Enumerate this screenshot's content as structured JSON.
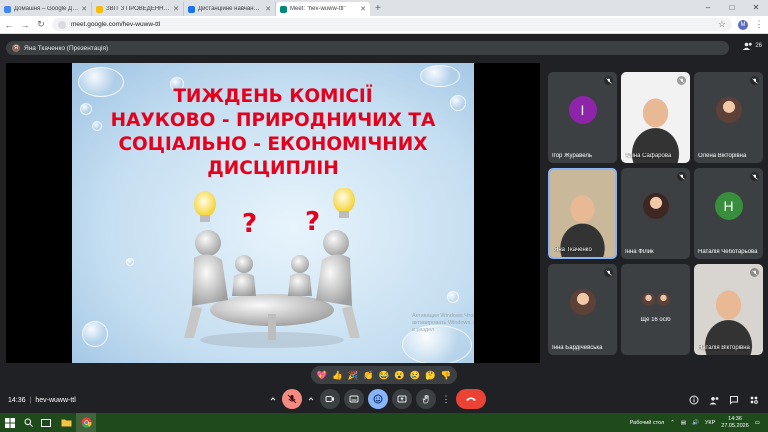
{
  "browser": {
    "tabs": [
      {
        "title": "Домашня – Google Диск",
        "color": "#4285f4",
        "active": false
      },
      {
        "title": "ЗВІТ З ПРОВЕДЕННЯ ТИЖНЯ",
        "color": "#fbbc04",
        "active": false
      },
      {
        "title": "Дистанційне навчання в ВСП",
        "color": "#1a73e8",
        "active": false
      },
      {
        "title": "Meet: \"hev-wuww-ttl\"",
        "color": "#00897b",
        "active": true
      }
    ],
    "new_tab": "+",
    "url": "meet.google.com/hev-wuww-ttl",
    "profile_initial": "M"
  },
  "meet": {
    "presenter_label": "Яна Ткаченко (Презентація)",
    "presenter_initial": "Я",
    "participant_count": "26",
    "slide": {
      "title_lines": [
        "ТИЖДЕНЬ КОМІСІЇ",
        "НАУКОВО - ПРИРОДНИЧИХ ТА",
        "СОЦІАЛЬНО - ЕКОНОМІЧНИХ",
        "ДИСЦИПЛІН"
      ],
      "watermark": "Активация Windows Чтобы активировать Windows, перейдите в раздел"
    },
    "tiles": [
      {
        "name": "Ігор Журавель",
        "type": "letter",
        "letter": "І",
        "bg": "#8e24aa",
        "tile_bg": "#3c4043",
        "muted": true
      },
      {
        "name": "Аліна Сафарова",
        "type": "photo",
        "tile_bg": "#f2f2f2",
        "muted": true
      },
      {
        "name": "Олена Вікторівна",
        "type": "photo-round",
        "tile_bg": "#3c4043",
        "muted": true
      },
      {
        "name": "Яна Ткаченко",
        "type": "photo",
        "tile_bg": "#c9b89a",
        "muted": false,
        "speaking": true
      },
      {
        "name": "Інна Філик",
        "type": "photo-round",
        "tile_bg": "#3c4043",
        "muted": true
      },
      {
        "name": "Наталія Чеботарьова",
        "type": "letter",
        "letter": "Н",
        "bg": "#388e3c",
        "tile_bg": "#3c4043",
        "muted": true
      },
      {
        "name": "Інна Бардічевська",
        "type": "photo-round",
        "tile_bg": "#3c4043",
        "muted": true
      },
      {
        "name": "Ще 16 осіб",
        "type": "more",
        "tile_bg": "#3c4043",
        "muted": false
      },
      {
        "name": "Наталія Вікторівна",
        "type": "photo",
        "tile_bg": "#d8d4cf",
        "muted": true
      }
    ],
    "reactions": [
      "💖",
      "👍",
      "🎉",
      "👏",
      "😂",
      "😮",
      "😢",
      "🤔",
      "👎"
    ],
    "meeting_time": "14:36",
    "meeting_code": "hev-wuww-ttl"
  },
  "taskbar": {
    "tray_text": "Рабочий стол",
    "lang": "УКР",
    "time": "14:36",
    "date": "27.05.2026"
  }
}
